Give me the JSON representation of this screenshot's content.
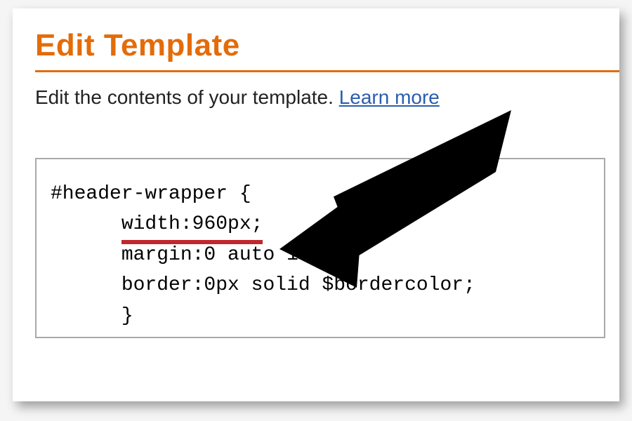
{
  "title": "Edit Template",
  "description_prefix": "Edit the contents of your template. ",
  "learn_more_label": "Learn more",
  "code": {
    "line1": "#header-wrapper {",
    "line2_indent": "      ",
    "line2_highlight": "width:960px;",
    "line3": "      margin:0 auto 10px;",
    "line4": "      border:0px solid $bordercolor;",
    "line5": "      }"
  }
}
